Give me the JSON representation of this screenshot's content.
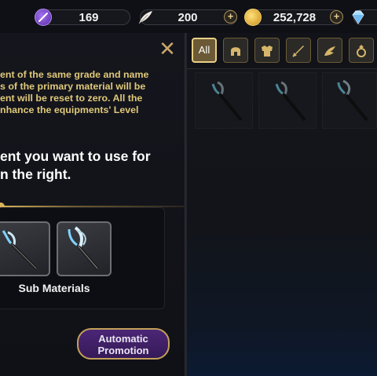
{
  "currencies": [
    {
      "name": "stamina",
      "icon": "purple-feather-icon",
      "value": "169",
      "color": "#7a45c8",
      "has_plus": false
    },
    {
      "name": "feather",
      "icon": "white-feather-icon",
      "value": "200",
      "color": "#e8e4da",
      "has_plus": true
    },
    {
      "name": "gold",
      "icon": "gold-coin-icon",
      "value": "252,728",
      "color": "#e2b23a",
      "has_plus": true
    },
    {
      "name": "diamond",
      "icon": "diamond-icon",
      "value": "",
      "color": "#9fd4ff",
      "has_plus": false
    }
  ],
  "left_panel": {
    "description_lines": [
      "ent of the same grade and name",
      "s of the primary material will be",
      "ent will be reset to zero. All the",
      "nhance the equipments' Level"
    ],
    "instruction_lines": [
      "ent you want to use for",
      "n the right."
    ],
    "sub_materials_label": "Sub Materials",
    "promotion_button": "Automatic Promotion"
  },
  "filter_tabs": [
    {
      "label": "All",
      "icon": "all-icon",
      "active": true
    },
    {
      "label": "",
      "icon": "helmet-icon",
      "active": false
    },
    {
      "label": "",
      "icon": "armor-icon",
      "active": false
    },
    {
      "label": "",
      "icon": "sword-icon",
      "active": false
    },
    {
      "label": "",
      "icon": "wing-icon",
      "active": false
    },
    {
      "label": "",
      "icon": "ring-icon",
      "active": false
    }
  ],
  "inventory_items": [
    {
      "icon": "wing-staff-icon"
    },
    {
      "icon": "wing-staff-icon"
    },
    {
      "icon": "wing-staff-icon"
    }
  ],
  "colors": {
    "accent_gold": "#d9b45a",
    "promo_purple": "#4b2676"
  }
}
